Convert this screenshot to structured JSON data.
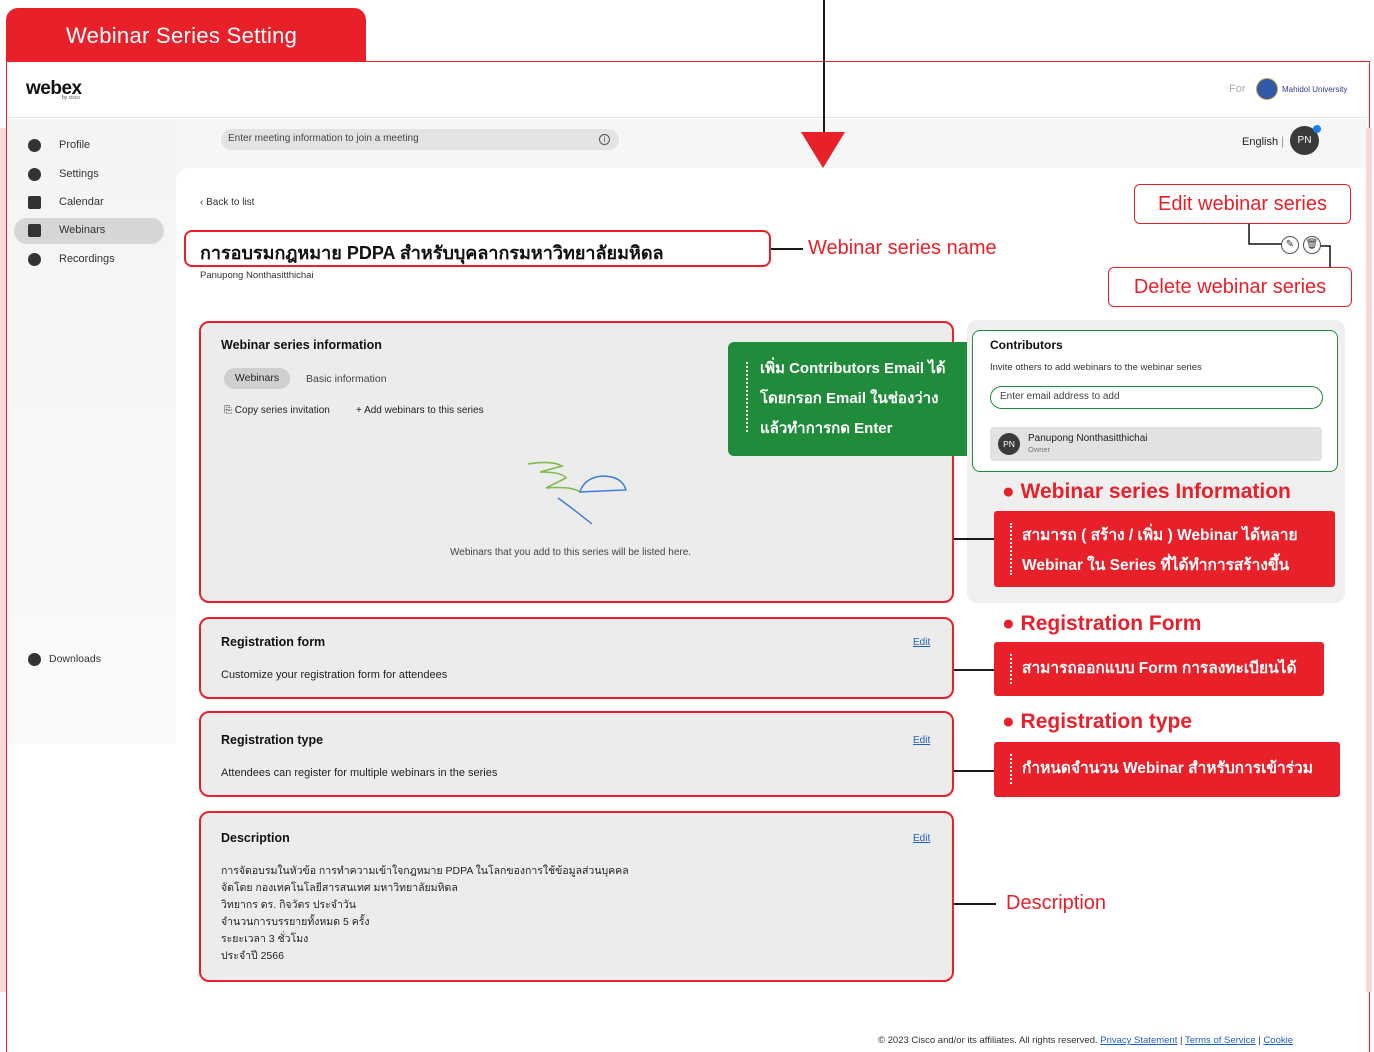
{
  "header_tab": {
    "label": "Webinar Series Setting"
  },
  "app": {
    "logo": "webex",
    "logo_sub": "by cisco",
    "for_label": "For",
    "org_name": "Mahidol University"
  },
  "sidebar": {
    "items": [
      {
        "label": "Profile",
        "icon": "profile-icon"
      },
      {
        "label": "Settings",
        "icon": "gear-icon"
      },
      {
        "label": "Calendar",
        "icon": "calendar-icon"
      },
      {
        "label": "Webinars",
        "icon": "webinar-icon",
        "active": true
      },
      {
        "label": "Recordings",
        "icon": "recording-icon"
      }
    ],
    "downloads": "Downloads"
  },
  "search": {
    "placeholder": "Enter meeting information to join a meeting"
  },
  "user": {
    "language": "English",
    "initials": "PN"
  },
  "page": {
    "back": "Back to list",
    "title": "การอบรมกฎหมาย PDPA สำหรับบุคลากรมหาวิทยาลัยมหิดล",
    "owner": "Panupong Nonthasitthichai"
  },
  "annotations": {
    "series_name": "Webinar series name",
    "edit": "Edit webinar series",
    "delete": "Delete webinar series",
    "description": "Description",
    "green_callout": [
      "เพิ่ม Contributors Email ได้",
      "โดยกรอก Email ในช่องว่าง",
      "แล้วทำการกด Enter"
    ],
    "info_head": "Webinar series Information",
    "info_note": [
      "สามารถ ( สร้าง / เพิ่ม ) Webinar ได้หลาย",
      "Webinar ใน Series ที่ได้ทำการสร้างขึ้น"
    ],
    "regform_head": "Registration Form",
    "regform_note": "สามารถออกแบบ Form การลงทะเบียนได้",
    "regtype_head": "Registration type",
    "regtype_note": "กำหนดจำนวน Webinar สำหรับการเข้าร่วม"
  },
  "series_info": {
    "title": "Webinar series information",
    "tabs": [
      "Webinars",
      "Basic information"
    ],
    "copy": "Copy series invitation",
    "add": "Add webinars to this series",
    "empty": "Webinars that you add to this series will be listed here."
  },
  "contributors": {
    "title": "Contributors",
    "subtitle": "Invite others to add webinars to the webinar series",
    "placeholder": "Enter email address to add",
    "member": {
      "initials": "PN",
      "name": "Panupong Nonthasitthichai",
      "role": "Owner"
    }
  },
  "registration_form": {
    "title": "Registration form",
    "text": "Customize your registration form for attendees",
    "edit": "Edit"
  },
  "registration_type": {
    "title": "Registration type",
    "text": "Attendees can register for multiple webinars in the series",
    "edit": "Edit"
  },
  "description": {
    "title": "Description",
    "edit": "Edit",
    "lines": [
      "การจัดอบรมในหัวข้อ การทำความเข้าใจกฎหมาย PDPA ในโลกของการใช้ข้อมูลส่วนบุคคล",
      "จัดโดย กองเทคโนโลยีสารสนเทศ มหาวิทยาลัยมหิดล",
      "วิทยากร ดร. กิจวัตร ประจำวัน",
      "จำนวนการบรรยายทั้งหมด 5 ครั้ง",
      "ระยะเวลา 3 ชั่วโมง",
      "ประจำปี 2566"
    ]
  },
  "footer": {
    "copyright": "© 2023 Cisco and/or its affiliates. All rights reserved.",
    "privacy": "Privacy Statement",
    "terms": "Terms of Service",
    "cookie": "Cookie"
  },
  "colors": {
    "accent": "#e8202a",
    "green": "#1f8b3b",
    "link": "#1b5fbf"
  }
}
